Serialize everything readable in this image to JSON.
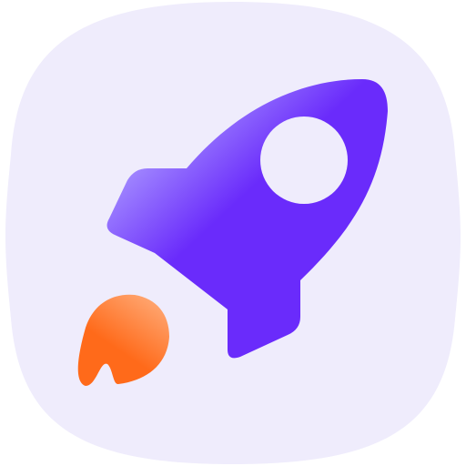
{
  "icon": {
    "name": "rocket-app-icon",
    "elements": [
      "squircle-background",
      "rocket-body",
      "rocket-window",
      "rocket-exhaust-flame"
    ]
  },
  "colors": {
    "background": "#efecfc",
    "rocket_light": "#a894ff",
    "rocket_dark": "#6a2bfb",
    "window": "#efecfc",
    "flame_light": "#ffa36c",
    "flame_dark": "#ff6a1a"
  }
}
